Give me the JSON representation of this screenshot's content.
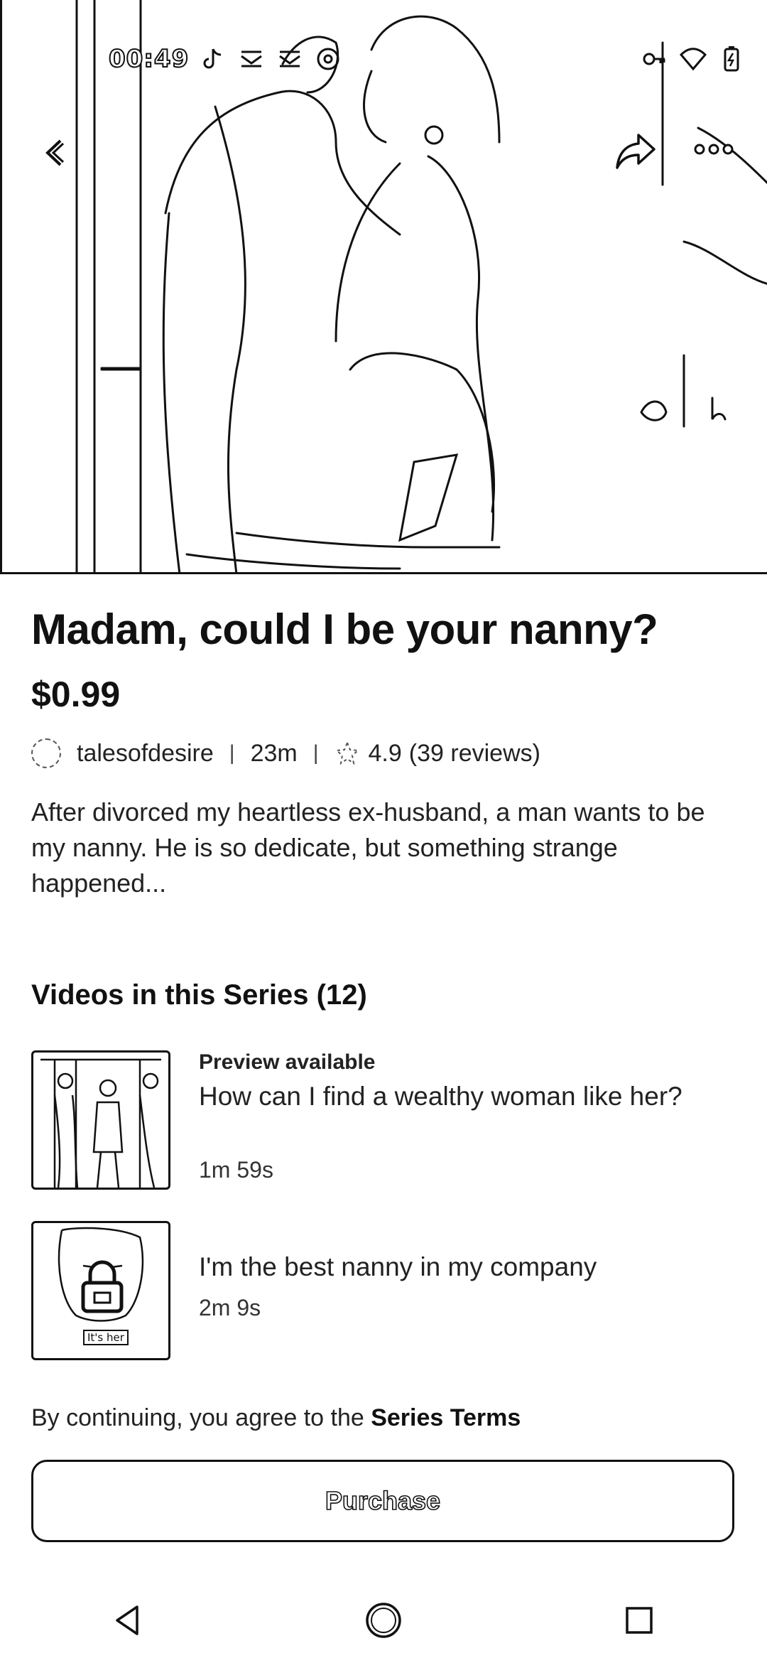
{
  "status_bar": {
    "time": "00:49",
    "left_icons": [
      "tiktok-icon",
      "mail-icon",
      "mail-icon",
      "threads-icon"
    ],
    "right_icons": [
      "vpn-key-icon",
      "wifi-icon",
      "battery-charging-icon"
    ]
  },
  "video": {
    "back_icon": "back-chevron-icon",
    "share_icon": "share-icon",
    "more_icon": "more-icon"
  },
  "series": {
    "title": "Madam, could I be your nanny?",
    "price": "$0.99",
    "creator": "talesofdesire",
    "duration": "23m",
    "rating": "4.9",
    "reviews": "(39 reviews)",
    "description": "After divorced my heartless ex-husband, a man wants to be my nanny. He is so dedicate, but something strange happened..."
  },
  "videos_section": {
    "title": "Videos in this Series (12)",
    "episodes": [
      {
        "badge": "Preview available",
        "title": "How can I find a wealthy woman like her?",
        "duration": "1m 59s",
        "locked": false
      },
      {
        "badge": "",
        "title": "I'm the best nanny in my company",
        "duration": "2m 9s",
        "locked": true,
        "thumb_caption": "It's her"
      }
    ]
  },
  "footer": {
    "terms_prefix": "By continuing, you agree to the ",
    "terms_link": "Series Terms",
    "purchase_label": "Purchase"
  },
  "nav_bar": {
    "icons": [
      "back-triangle-icon",
      "home-circle-icon",
      "recents-square-icon"
    ]
  }
}
